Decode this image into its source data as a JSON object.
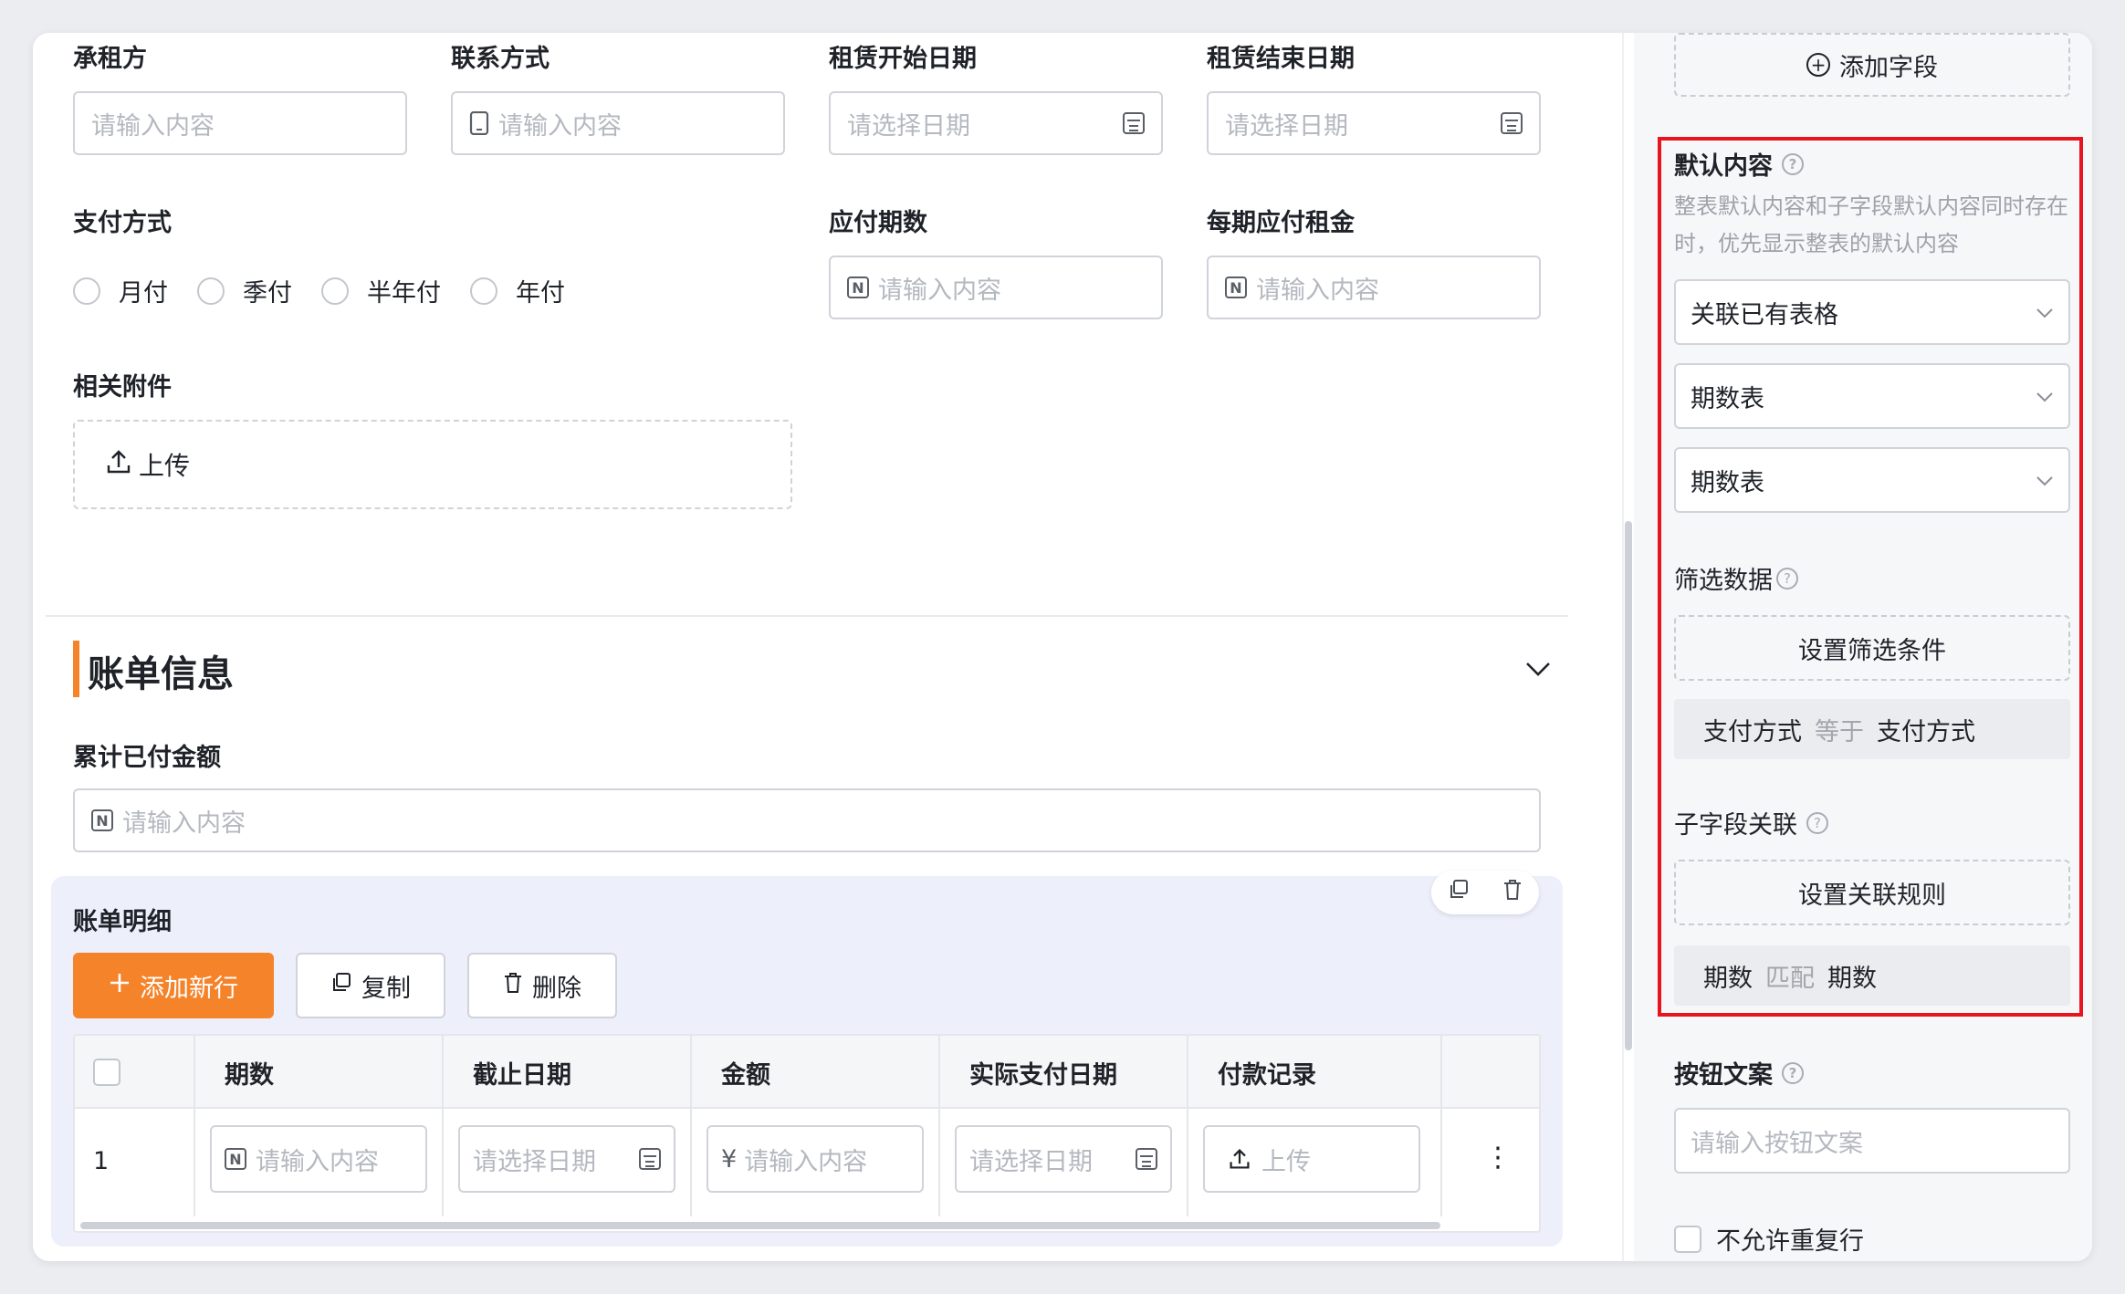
{
  "form": {
    "row1": [
      {
        "label": "承租方",
        "placeholder": "请输入内容",
        "prefix": "",
        "suffix": ""
      },
      {
        "label": "联系方式",
        "placeholder": "请输入内容",
        "prefix": "phone-icon",
        "suffix": ""
      },
      {
        "label": "租赁开始日期",
        "placeholder": "请选择日期",
        "prefix": "",
        "suffix": "calendar-icon"
      },
      {
        "label": "租赁结束日期",
        "placeholder": "请选择日期",
        "prefix": "",
        "suffix": "calendar-icon"
      }
    ],
    "payment": {
      "label": "支付方式",
      "options": [
        "月付",
        "季付",
        "半年付",
        "年付"
      ]
    },
    "periods": {
      "label": "应付期数",
      "placeholder": "请输入内容",
      "prefix": "N"
    },
    "rent": {
      "label": "每期应付租金",
      "placeholder": "请输入内容",
      "prefix": "N"
    },
    "attachments": {
      "label": "相关附件",
      "upload_label": "上传"
    }
  },
  "bill_section": {
    "title": "账单信息",
    "accent_color": "#f5832a",
    "paid_total": {
      "label": "累计已付金额",
      "placeholder": "请输入内容",
      "prefix": "N"
    },
    "details": {
      "title": "账单明细",
      "add_row_label": "添加新行",
      "copy_label": "复制",
      "delete_label": "删除",
      "columns": [
        "期数",
        "截止日期",
        "金额",
        "实际支付日期",
        "付款记录"
      ],
      "rows": [
        {
          "index": "1",
          "cells": [
            {
              "placeholder": "请输入内容",
              "prefix": "N"
            },
            {
              "placeholder": "请选择日期",
              "suffix": "calendar-icon"
            },
            {
              "placeholder": "请输入内容",
              "prefix": "¥"
            },
            {
              "placeholder": "请选择日期",
              "suffix": "calendar-icon"
            },
            {
              "placeholder": "上传",
              "prefix": "upload-icon"
            }
          ]
        }
      ]
    }
  },
  "panel": {
    "add_field_label": "添加字段",
    "highlight_color": "#e8141f",
    "default_content": {
      "label": "默认内容",
      "hint": "整表默认内容和子字段默认内容同时存在时，优先显示整表的默认内容",
      "select1": "关联已有表格",
      "select2": "期数表",
      "select3": "期数表"
    },
    "filter": {
      "label": "筛选数据",
      "button": "设置筛选条件",
      "rule": {
        "left": "支付方式",
        "op": "等于",
        "right": "支付方式"
      }
    },
    "sub_link": {
      "label": "子字段关联",
      "button": "设置关联规则",
      "rule": {
        "left": "期数",
        "op": "匹配",
        "right": "期数"
      }
    },
    "button_text": {
      "label": "按钮文案",
      "placeholder": "请输入按钮文案"
    },
    "no_duplicate_label": "不允许重复行"
  }
}
